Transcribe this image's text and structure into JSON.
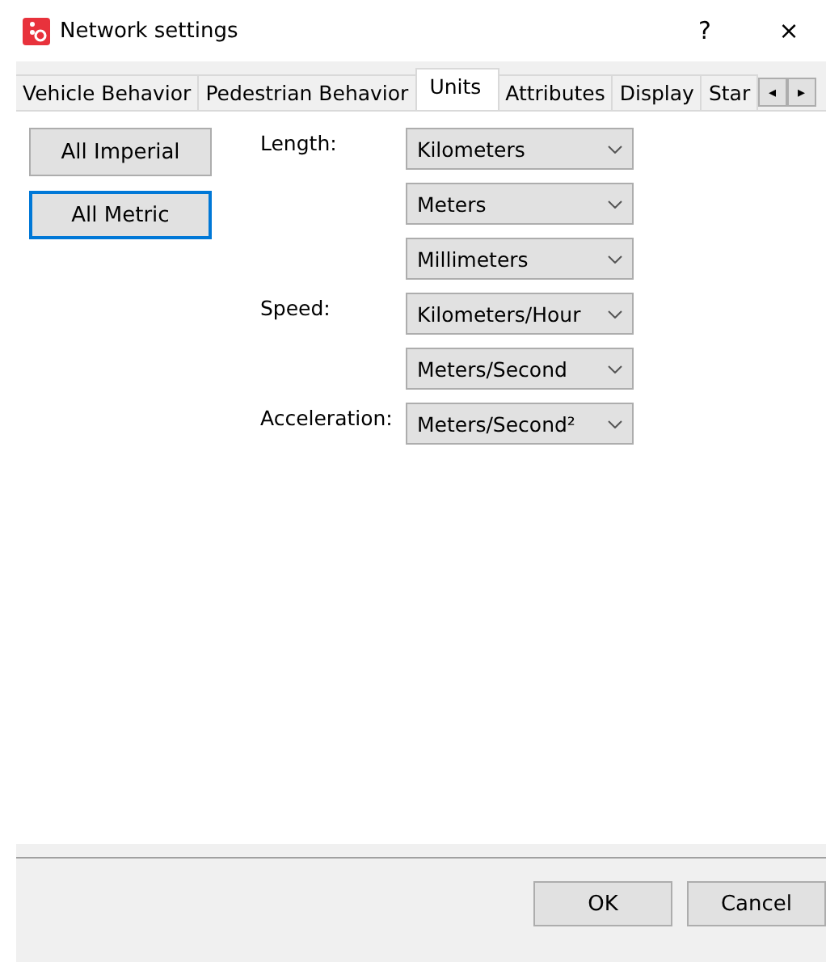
{
  "window": {
    "title": "Network settings",
    "help": "?",
    "close": "×"
  },
  "tabs": [
    {
      "label": "Vehicle Behavior",
      "selected": false
    },
    {
      "label": "Pedestrian Behavior",
      "selected": false
    },
    {
      "label": "Units",
      "selected": true
    },
    {
      "label": "Attributes",
      "selected": false
    },
    {
      "label": "Display",
      "selected": false
    },
    {
      "label": "Star",
      "selected": false
    }
  ],
  "tab_scroll": [
    "◂",
    "▸"
  ],
  "preset_buttons": [
    {
      "label": "All Imperial",
      "focused": false
    },
    {
      "label": "All Metric",
      "focused": true
    }
  ],
  "units": [
    {
      "label": "Length:",
      "value": "Kilometers"
    },
    {
      "value": "Meters"
    },
    {
      "value": "Millimeters"
    },
    {
      "label": "Speed:",
      "value": "Kilometers/Hour"
    },
    {
      "value": "Meters/Second"
    },
    {
      "label": "Acceleration:",
      "value": "Meters/Second²"
    }
  ],
  "buttons": [
    "OK",
    "Cancel"
  ]
}
